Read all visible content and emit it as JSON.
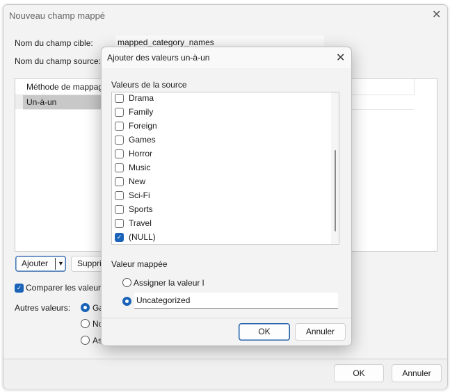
{
  "main": {
    "title": "Nouveau champ mappé",
    "target_label": "Nom du champ cible:",
    "target_value": "mapped_category_names",
    "source_label": "Nom du champ source:",
    "table_header": "Méthode de mappage",
    "table_row": "Un-à-un",
    "add_label": "Ajouter",
    "remove_label": "Supprimer",
    "compare_label": "Comparer les valeurs",
    "compare_checked": true,
    "other_label": "Autres valeurs:",
    "other_options": [
      "Ga",
      "No",
      "As"
    ],
    "other_selected": 0,
    "ok": "OK",
    "cancel": "Annuler"
  },
  "modal": {
    "title": "Ajouter des valeurs un-à-un",
    "source_label": "Valeurs de la source",
    "items": [
      {
        "label": "Drama",
        "checked": false
      },
      {
        "label": "Family",
        "checked": false
      },
      {
        "label": "Foreign",
        "checked": false
      },
      {
        "label": "Games",
        "checked": false
      },
      {
        "label": "Horror",
        "checked": false
      },
      {
        "label": "Music",
        "checked": false
      },
      {
        "label": "New",
        "checked": false
      },
      {
        "label": "Sci-Fi",
        "checked": false
      },
      {
        "label": "Sports",
        "checked": false
      },
      {
        "label": "Travel",
        "checked": false
      },
      {
        "label": "(NULL)",
        "checked": true
      }
    ],
    "mapped_label": "Valeur mappée",
    "option_assign": "Assigner la valeur l",
    "option_custom_value": "Uncategorized",
    "selected_option": 1,
    "ok": "OK",
    "cancel": "Annuler"
  },
  "colors": {
    "accent": "#1a63b8"
  }
}
